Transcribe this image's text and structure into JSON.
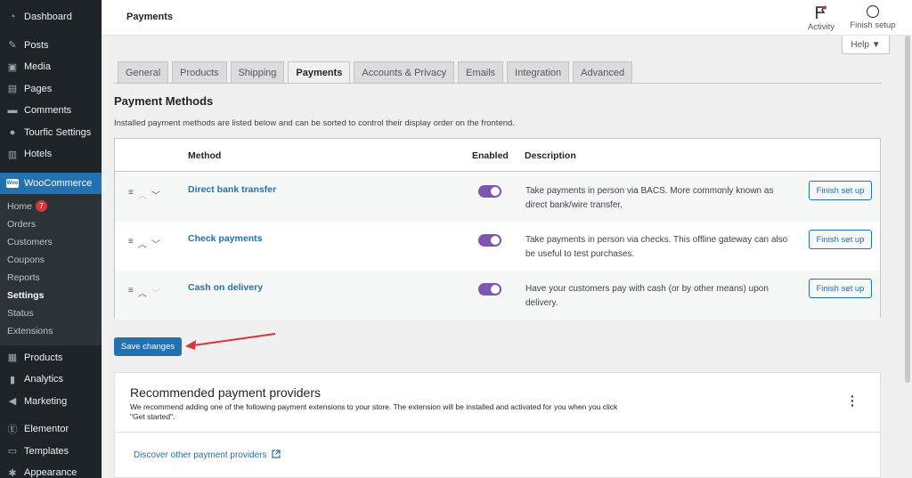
{
  "sidebar": {
    "top_items": [
      {
        "label": "Dashboard",
        "icon": "dashboard-icon"
      },
      {
        "label": "Posts",
        "icon": "pin-icon"
      },
      {
        "label": "Media",
        "icon": "media-icon"
      },
      {
        "label": "Pages",
        "icon": "pages-icon"
      },
      {
        "label": "Comments",
        "icon": "comments-icon"
      },
      {
        "label": "Tourfic Settings",
        "icon": "tourfic-icon"
      },
      {
        "label": "Hotels",
        "icon": "hotel-icon"
      }
    ],
    "woocommerce_label": "WooCommerce",
    "woo_logo": "Woo",
    "submenu": [
      {
        "label": "Home",
        "badge": "7"
      },
      {
        "label": "Orders"
      },
      {
        "label": "Customers"
      },
      {
        "label": "Coupons"
      },
      {
        "label": "Reports"
      },
      {
        "label": "Settings"
      },
      {
        "label": "Status"
      },
      {
        "label": "Extensions"
      }
    ],
    "bottom_items": [
      {
        "label": "Products",
        "icon": "products-icon"
      },
      {
        "label": "Analytics",
        "icon": "analytics-icon"
      },
      {
        "label": "Marketing",
        "icon": "marketing-icon"
      },
      {
        "label": "Elementor",
        "icon": "elementor-icon"
      },
      {
        "label": "Templates",
        "icon": "templates-icon"
      },
      {
        "label": "Appearance",
        "icon": "appearance-icon"
      }
    ]
  },
  "topbar": {
    "title": "Payments",
    "activity_label": "Activity",
    "finish_setup_label": "Finish setup",
    "help_label": "Help ▼"
  },
  "tabs": [
    {
      "label": "General",
      "active": false
    },
    {
      "label": "Products",
      "active": false
    },
    {
      "label": "Shipping",
      "active": false
    },
    {
      "label": "Payments",
      "active": true
    },
    {
      "label": "Accounts & Privacy",
      "active": false
    },
    {
      "label": "Emails",
      "active": false
    },
    {
      "label": "Integration",
      "active": false
    },
    {
      "label": "Advanced",
      "active": false
    }
  ],
  "section": {
    "title": "Payment Methods",
    "description": "Installed payment methods are listed below and can be sorted to control their display order on the frontend."
  },
  "table": {
    "headers": {
      "method": "Method",
      "enabled": "Enabled",
      "description": "Description"
    },
    "rows": [
      {
        "name": "Direct bank transfer",
        "enabled": true,
        "description": "Take payments in person via BACS. More commonly known as direct bank/wire transfer.",
        "action": "Finish set up"
      },
      {
        "name": "Check payments",
        "enabled": true,
        "description": "Take payments in person via checks. This offline gateway can also be useful to test purchases.",
        "action": "Finish set up"
      },
      {
        "name": "Cash on delivery",
        "enabled": true,
        "description": "Have your customers pay with cash (or by other means) upon delivery.",
        "action": "Finish set up"
      }
    ]
  },
  "save_label": "Save changes",
  "recommended": {
    "title": "Recommended payment providers",
    "description": "We recommend adding one of the following payment extensions to your store. The extension will be installed and activated for you when you click \"Get started\".",
    "discover_label": "Discover other payment providers"
  },
  "colors": {
    "accent": "#2271b1",
    "toggle_on": "#7f54b3",
    "sidebar_bg": "#1d2327",
    "annotation_arrow": "#d63638"
  }
}
